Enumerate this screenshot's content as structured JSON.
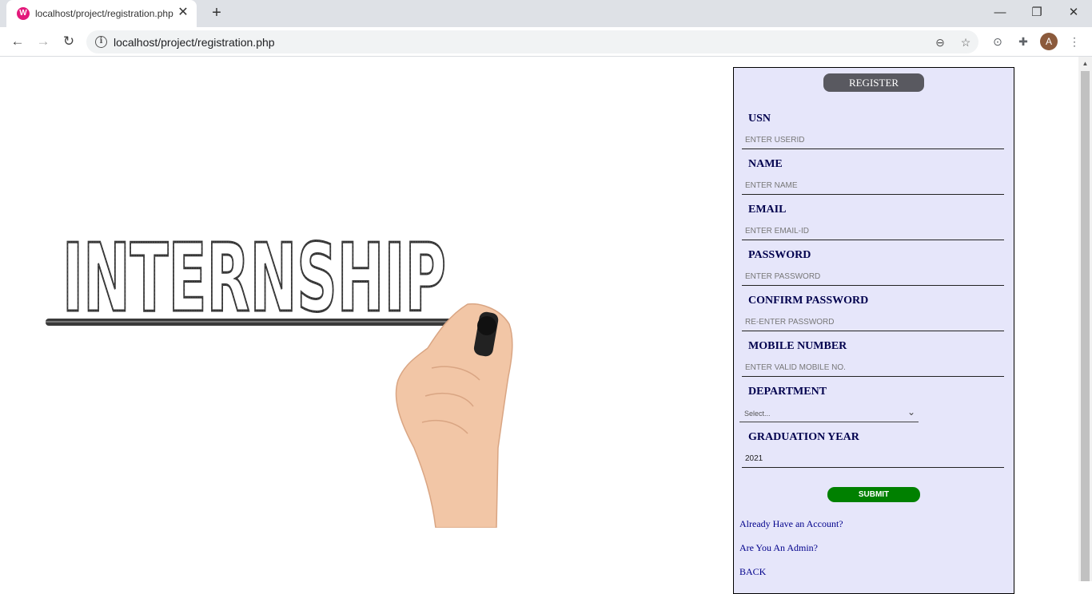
{
  "browser": {
    "tab_title": "localhost/project/registration.php",
    "url": "localhost/project/registration.php"
  },
  "icons": {
    "tab_favicon": "wamp-icon",
    "tab_close": "close-icon",
    "new_tab": "plus-icon",
    "minimize": "minimize-icon",
    "maximize": "restore-icon",
    "close_window": "close-icon",
    "back": "arrow-left-icon",
    "forward": "arrow-right-icon",
    "reload": "reload-icon",
    "info": "info-icon",
    "zoom": "zoom-out-icon",
    "bookmark": "star-icon",
    "extensions": "puzzle-icon",
    "menu": "kebab-icon"
  },
  "profile": {
    "initial": "A"
  },
  "hero": {
    "image_text": "INTERNSHIP"
  },
  "form": {
    "header": "REGISTER",
    "fields": [
      {
        "label": "USN",
        "placeholder": "ENTER USERID"
      },
      {
        "label": "NAME",
        "placeholder": "ENTER NAME"
      },
      {
        "label": "EMAIL",
        "placeholder": "ENTER EMAIL-ID"
      },
      {
        "label": "PASSWORD",
        "placeholder": "ENTER PASSWORD"
      },
      {
        "label": "CONFIRM PASSWORD",
        "placeholder": "RE-ENTER PASSWORD"
      },
      {
        "label": "MOBILE NUMBER",
        "placeholder": "ENTER VALID MOBILE NO."
      }
    ],
    "department": {
      "label": "DEPARTMENT",
      "selected": "Select..."
    },
    "graduation": {
      "label": "GRADUATION YEAR",
      "value": "2021"
    },
    "submit_label": "SUBMIT",
    "links": {
      "login": "Already Have an Account?",
      "admin": "Are You An Admin?",
      "back": "BACK"
    }
  },
  "colors": {
    "form_bg": "#e6e6fa",
    "register_bg": "#595960",
    "submit_bg": "#008000",
    "label_color": "#00004d",
    "link_color": "#00008b"
  }
}
